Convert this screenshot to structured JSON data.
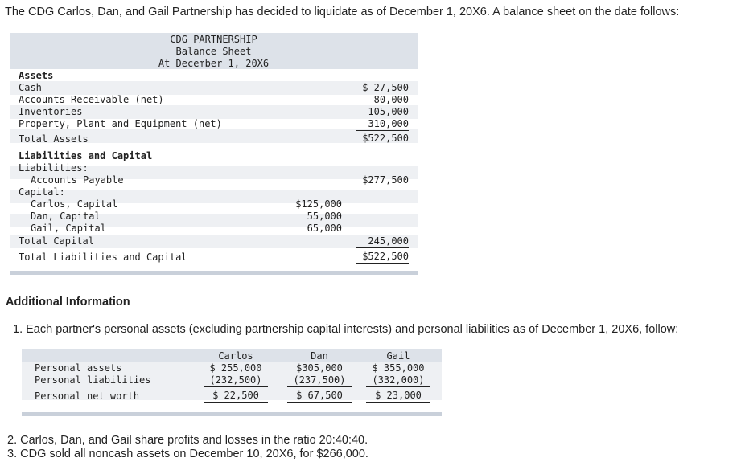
{
  "intro": "The CDG Carlos, Dan, and Gail Partnership has decided to liquidate as of December 1, 20X6. A balance sheet on the date follows:",
  "balance_sheet": {
    "title_lines": [
      "CDG PARTNERSHIP",
      "Balance Sheet",
      "At December 1, 20X6"
    ],
    "assets_heading": "Assets",
    "cash": {
      "label": "Cash",
      "amount": "$ 27,500"
    },
    "accounts_receivable": {
      "label": "Accounts Receivable (net)",
      "amount": "80,000"
    },
    "inventories": {
      "label": "Inventories",
      "amount": "105,000"
    },
    "ppe": {
      "label": "Property, Plant and Equipment (net)",
      "amount": "310,000"
    },
    "total_assets": {
      "label": "Total Assets",
      "amount": "$522,500"
    },
    "liab_cap_heading": "Liabilities and Capital",
    "liabilities_heading": "Liabilities:",
    "accounts_payable": {
      "label": "Accounts Payable",
      "amount": "$277,500"
    },
    "capital_heading": "Capital:",
    "carlos": {
      "label": "Carlos, Capital",
      "amount": "$125,000"
    },
    "dan": {
      "label": "Dan, Capital",
      "amount": "55,000"
    },
    "gail": {
      "label": "Gail, Capital",
      "amount": "65,000"
    },
    "total_capital": {
      "label": "Total Capital",
      "amount": "245,000"
    },
    "total_liab_cap": {
      "label": "Total Liabilities and Capital",
      "amount": "$522,500"
    }
  },
  "additional_heading": "Additional Information",
  "item1": "1. Each partner's personal assets (excluding partnership capital interests) and personal liabilities as of December 1, 20X6, follow:",
  "personal": {
    "headers": [
      "Carlos",
      "Dan",
      "Gail"
    ],
    "rows": [
      {
        "label": "Personal assets",
        "values": [
          "$ 255,000",
          "$305,000",
          "$ 355,000"
        ]
      },
      {
        "label": "Personal liabilities",
        "values": [
          "(232,500)",
          "(237,500)",
          "(332,000)"
        ]
      },
      {
        "label": "Personal net worth",
        "values": [
          "$  22,500",
          "$ 67,500",
          "$  23,000"
        ]
      }
    ]
  },
  "item2": "2. Carlos, Dan, and Gail share profits and losses in the ratio 20:40:40.",
  "item3": "3. CDG sold all noncash assets on December 10, 20X6, for $266,000."
}
